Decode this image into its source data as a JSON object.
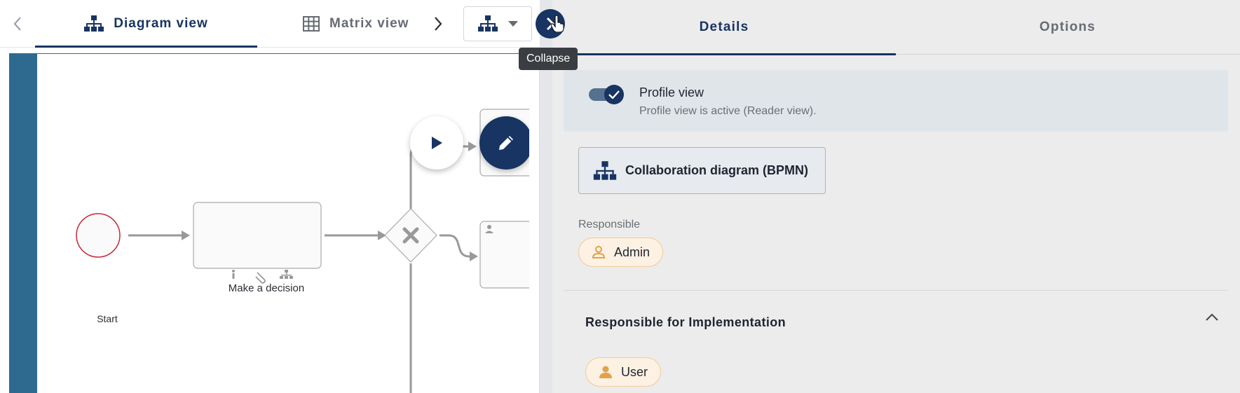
{
  "left": {
    "tabs": [
      {
        "label": "Diagram view",
        "active": true,
        "icon": "org-chart-icon"
      },
      {
        "label": "Matrix view",
        "active": false,
        "icon": "grid-icon"
      }
    ],
    "view_select": {
      "icon": "org-chart-icon"
    },
    "diagram": {
      "start_label": "Start",
      "task_label": "Make a decision",
      "gateway": "exclusive-gateway"
    }
  },
  "collapse": {
    "tooltip": "Collapse"
  },
  "right": {
    "tabs": [
      {
        "label": "Details",
        "active": true
      },
      {
        "label": "Options",
        "active": false
      }
    ],
    "profile": {
      "title": "Profile view",
      "subtitle": "Profile view is active (Reader view).",
      "enabled": true
    },
    "bpmn_button": "Collaboration diagram (BPMN)",
    "responsible": {
      "label": "Responsible",
      "value": "Admin"
    },
    "implementation": {
      "title": "Responsible for Implementation",
      "value": "User"
    }
  },
  "colors": {
    "primary": "#173462",
    "lane": "#2e6a90",
    "chip_bg": "#fdf1e3",
    "chip_icon": "#e3a24a",
    "start_event": "#c8283b"
  }
}
